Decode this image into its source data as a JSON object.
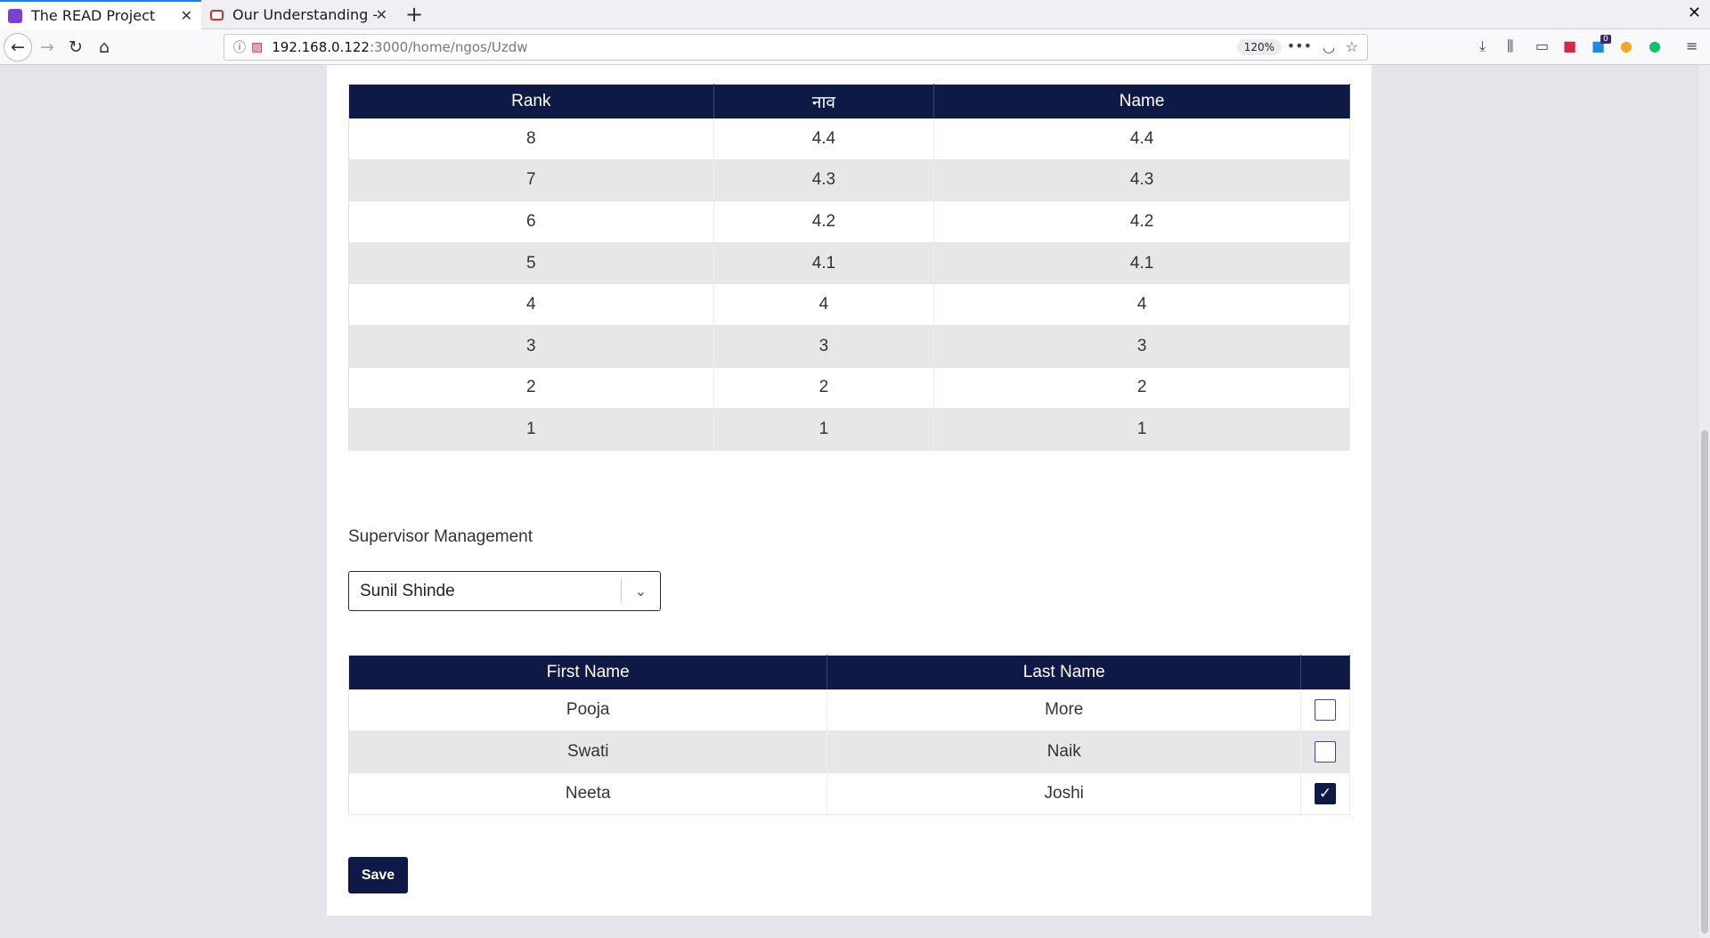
{
  "browser": {
    "tabs": [
      {
        "title": "The READ Project",
        "active": true,
        "favicon_color": "#7b3fd1"
      },
      {
        "title": "Our Understanding - e",
        "active": false,
        "favicon_color": "#d93025"
      }
    ],
    "url_host": "192.168.0.122",
    "url_path": ":3000/home/ngos/Uzdw",
    "zoom": "120%",
    "badge_count": "0"
  },
  "rank_table": {
    "headers": [
      "Rank",
      "नाव",
      "Name"
    ],
    "rows": [
      [
        "8",
        "4.4",
        "4.4"
      ],
      [
        "7",
        "4.3",
        "4.3"
      ],
      [
        "6",
        "4.2",
        "4.2"
      ],
      [
        "5",
        "4.1",
        "4.1"
      ],
      [
        "4",
        "4",
        "4"
      ],
      [
        "3",
        "3",
        "3"
      ],
      [
        "2",
        "2",
        "2"
      ],
      [
        "1",
        "1",
        "1"
      ]
    ]
  },
  "supervisor": {
    "section_title": "Supervisor Management",
    "selected": "Sunil Shinde",
    "headers": [
      "First Name",
      "Last Name"
    ],
    "rows": [
      {
        "first": "Pooja",
        "last": "More",
        "checked": false
      },
      {
        "first": "Swati",
        "last": "Naik",
        "checked": false
      },
      {
        "first": "Neeta",
        "last": "Joshi",
        "checked": true
      }
    ],
    "save_label": "Save"
  },
  "colors": {
    "header_navy": "#0e1a45",
    "row_stripe": "#e7e7e7",
    "page_bg": "#e4e4ea"
  }
}
